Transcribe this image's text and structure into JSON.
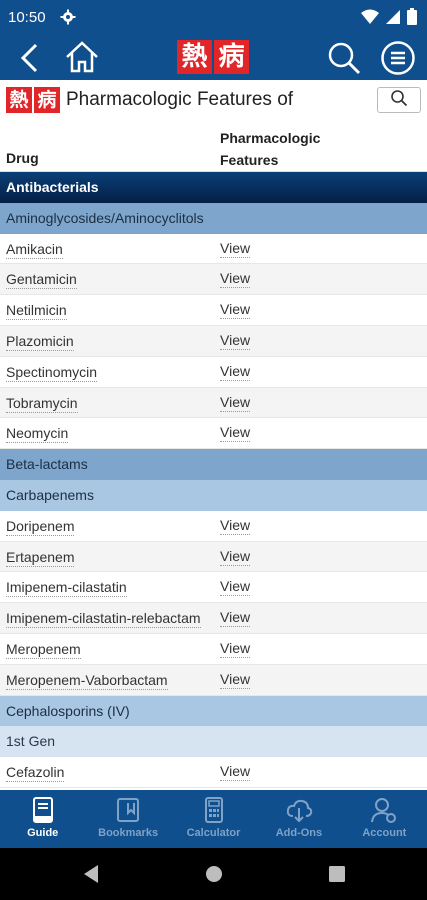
{
  "status_bar": {
    "time": "10:50"
  },
  "app": {
    "logo_chars": [
      "熱",
      "病"
    ]
  },
  "title_bar": {
    "title": "Pharmacologic Features of"
  },
  "table": {
    "headers": {
      "drug": "Drug",
      "features": "Pharmacologic Features"
    },
    "rows": [
      {
        "type": "section",
        "label": "Antibacterials"
      },
      {
        "type": "cat",
        "label": "Aminoglycosides/Aminocyclitols"
      },
      {
        "type": "drug",
        "label": "Amikacin",
        "link": "View"
      },
      {
        "type": "drug",
        "label": "Gentamicin",
        "link": "View"
      },
      {
        "type": "drug",
        "label": "Netilmicin",
        "link": "View"
      },
      {
        "type": "drug",
        "label": "Plazomicin",
        "link": "View"
      },
      {
        "type": "drug",
        "label": "Spectinomycin",
        "link": "View"
      },
      {
        "type": "drug",
        "label": "Tobramycin",
        "link": "View"
      },
      {
        "type": "drug",
        "label": "Neomycin",
        "link": "View"
      },
      {
        "type": "cat",
        "label": "Beta-lactams"
      },
      {
        "type": "sub",
        "label": "Carbapenems"
      },
      {
        "type": "drug",
        "label": "Doripenem",
        "link": "View"
      },
      {
        "type": "drug",
        "label": "Ertapenem",
        "link": "View"
      },
      {
        "type": "drug",
        "label": "Imipenem-cilastatin",
        "link": "View"
      },
      {
        "type": "drug",
        "label": "Imipenem-cilastatin-relebactam",
        "link": "View"
      },
      {
        "type": "drug",
        "label": "Meropenem",
        "link": "View"
      },
      {
        "type": "drug",
        "label": "Meropenem-Vaborbactam",
        "link": "View"
      },
      {
        "type": "sub",
        "label": "Cephalosporins (IV)"
      },
      {
        "type": "sub2",
        "label": "1st Gen"
      },
      {
        "type": "drug",
        "label": "Cefazolin",
        "link": "View"
      }
    ]
  },
  "bottom_nav": {
    "tabs": [
      {
        "label": "Guide",
        "icon": "book-icon",
        "active": true
      },
      {
        "label": "Bookmarks",
        "icon": "bookmark-icon",
        "active": false
      },
      {
        "label": "Calculator",
        "icon": "calculator-icon",
        "active": false
      },
      {
        "label": "Add-Ons",
        "icon": "download-icon",
        "active": false
      },
      {
        "label": "Account",
        "icon": "account-icon",
        "active": false
      }
    ]
  },
  "colors": {
    "header_blue": "#0f4f8e",
    "logo_red": "#e02628",
    "section_navy": "#041f45",
    "category_blue": "#7ea6cc",
    "subcategory_blue": "#a9c6e3"
  }
}
